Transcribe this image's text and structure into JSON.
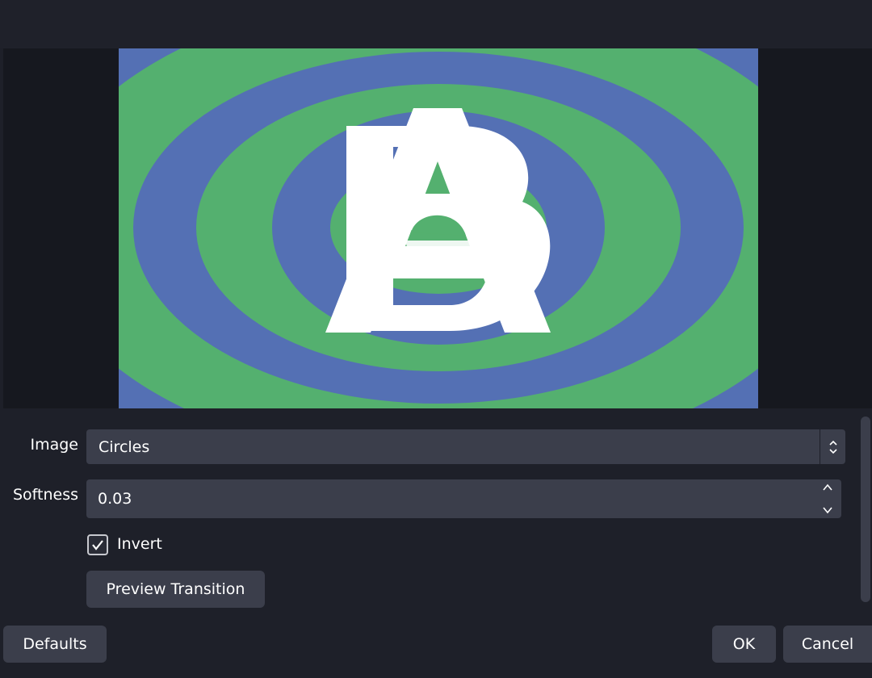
{
  "preview": {
    "colors": {
      "blue": "#5470b4",
      "green": "#54b06f",
      "letters": "#ffffff"
    },
    "letters": [
      "B",
      "A"
    ]
  },
  "form": {
    "image_label": "Image",
    "image_value": "Circles",
    "softness_label": "Softness",
    "softness_value": "0.03",
    "invert_label": "Invert",
    "invert_checked": true,
    "preview_button": "Preview Transition"
  },
  "footer": {
    "defaults": "Defaults",
    "ok": "OK",
    "cancel": "Cancel"
  }
}
